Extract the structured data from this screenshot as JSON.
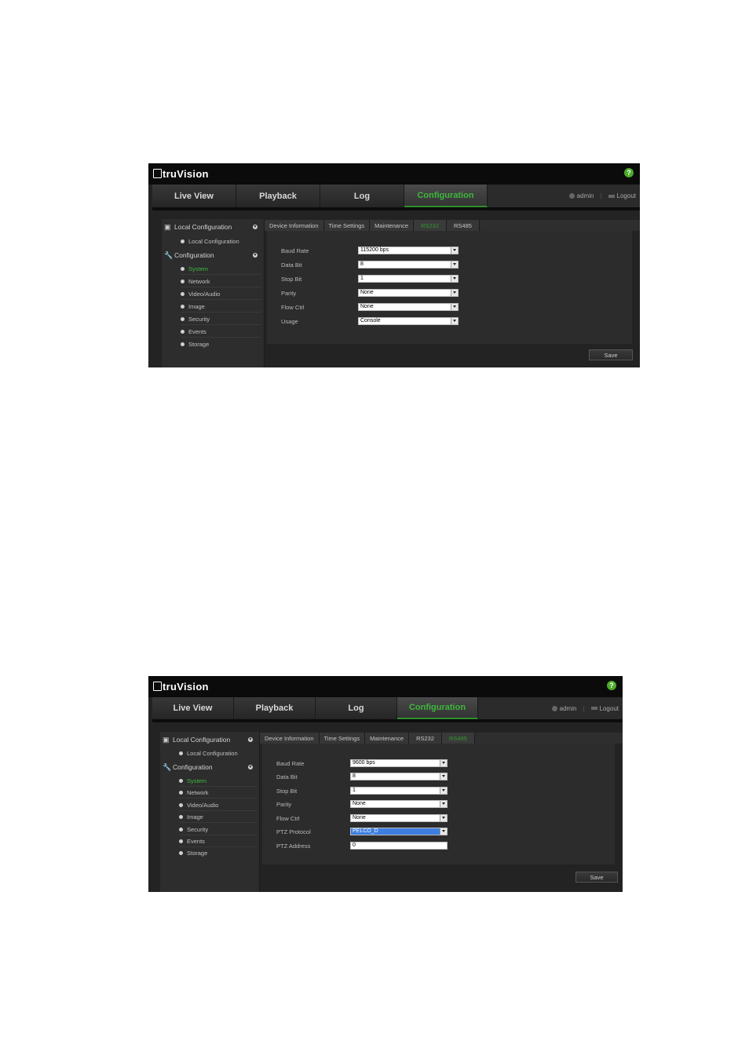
{
  "screen1": {
    "brand": "truVision",
    "help_symbol": "?",
    "nav": [
      {
        "label": "Live View"
      },
      {
        "label": "Playback"
      },
      {
        "label": "Log"
      },
      {
        "label": "Configuration",
        "active": true
      }
    ],
    "user": "admin",
    "logout": "Logout",
    "sidebar": {
      "local_header": "Local Configuration",
      "local_items": [
        "Local Configuration"
      ],
      "config_header": "Configuration",
      "config_items": [
        "System",
        "Network",
        "Video/Audio",
        "Image",
        "Security",
        "Events",
        "Storage"
      ],
      "active_item": "System"
    },
    "tabs": [
      "Device Information",
      "Time Settings",
      "Maintenance",
      "RS232",
      "RS485"
    ],
    "active_tab": "RS232",
    "fields": [
      {
        "label": "Baud Rate",
        "value": "115200 bps"
      },
      {
        "label": "Data Bit",
        "value": "8"
      },
      {
        "label": "Stop Bit",
        "value": "1"
      },
      {
        "label": "Parity",
        "value": "None"
      },
      {
        "label": "Flow Ctrl",
        "value": "None"
      },
      {
        "label": "Usage",
        "value": "Console"
      }
    ],
    "save": "Save"
  },
  "screen2": {
    "brand": "truVision",
    "help_symbol": "?",
    "nav": [
      {
        "label": "Live View"
      },
      {
        "label": "Playback"
      },
      {
        "label": "Log"
      },
      {
        "label": "Configuration",
        "active": true
      }
    ],
    "user": "admin",
    "logout": "Logout",
    "sidebar": {
      "local_header": "Local Configuration",
      "local_items": [
        "Local Configuration"
      ],
      "config_header": "Configuration",
      "config_items": [
        "System",
        "Network",
        "Video/Audio",
        "Image",
        "Security",
        "Events",
        "Storage"
      ],
      "active_item": "System"
    },
    "tabs": [
      "Device Information",
      "Time Settings",
      "Maintenance",
      "RS232",
      "RS485"
    ],
    "active_tab": "RS485",
    "fields": [
      {
        "label": "Baud Rate",
        "value": "9600 bps",
        "type": "select"
      },
      {
        "label": "Data Bit",
        "value": "8",
        "type": "select"
      },
      {
        "label": "Stop Bit",
        "value": "1",
        "type": "select"
      },
      {
        "label": "Parity",
        "value": "None",
        "type": "select"
      },
      {
        "label": "Flow Ctrl",
        "value": "None",
        "type": "select"
      },
      {
        "label": "PTZ Protocol",
        "value": "PELCO_D",
        "type": "select",
        "selected": true
      },
      {
        "label": "PTZ Address",
        "value": "0",
        "type": "text"
      }
    ],
    "save": "Save"
  },
  "colors": {
    "active_green": "#3db83d",
    "nav_bg": "#2b2b2b",
    "top_bg": "#0b0b0b",
    "panel_bg": "#2c2c2c",
    "highlight_blue": "#3d7ee0"
  }
}
